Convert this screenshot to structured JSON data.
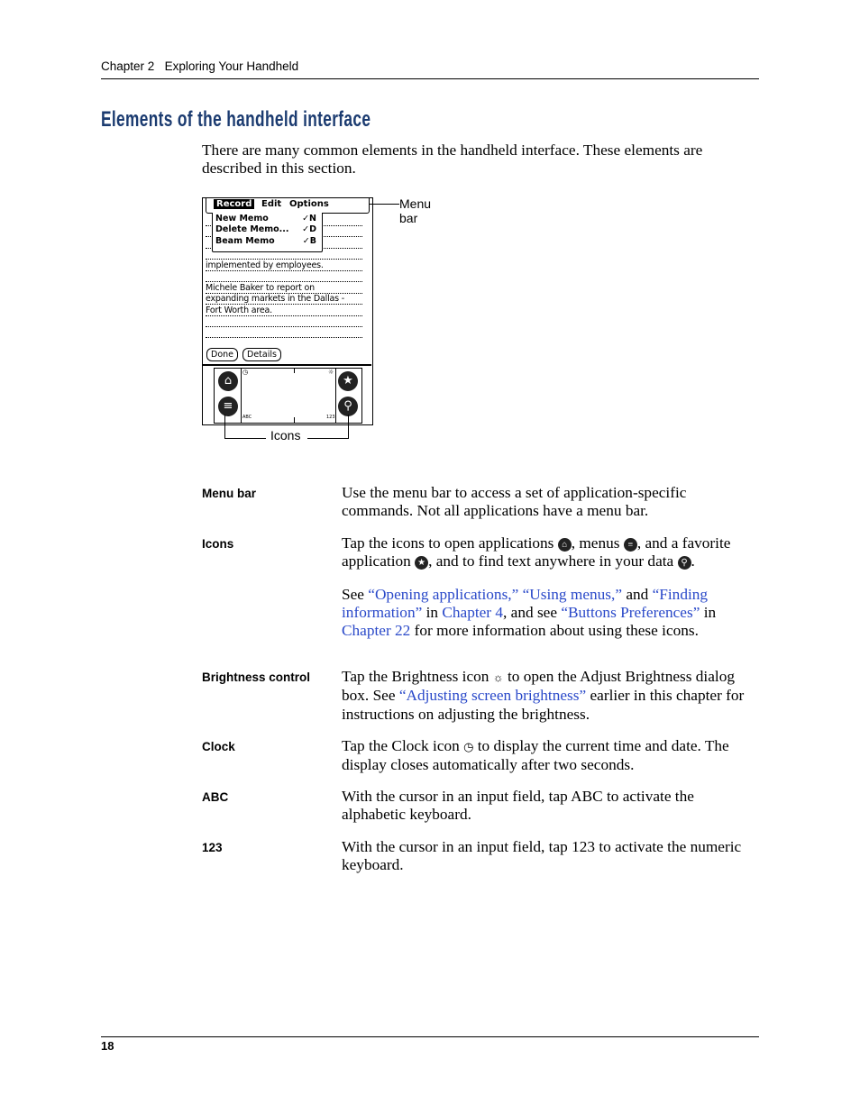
{
  "header": {
    "chapter": "Chapter 2",
    "section": "Exploring Your Handheld"
  },
  "title": "Elements of the handheld interface",
  "intro": "There are many common elements in the handheld interface. These elements are described in this section.",
  "figure": {
    "menus": [
      "Record",
      "Edit",
      "Options"
    ],
    "menu_items": [
      {
        "label": "New Memo",
        "shortcut": "✓N"
      },
      {
        "label": "Delete Memo...",
        "shortcut": "✓D"
      },
      {
        "label": "Beam Memo",
        "shortcut": "✓B"
      }
    ],
    "memo_lines": [
      "implemented by employees.",
      "Michele Baker to report on",
      "expanding markets in the Dallas -",
      "Fort Worth area."
    ],
    "buttons": [
      "Done",
      "Details"
    ],
    "silk": {
      "abc": "ABC",
      "num": "123"
    },
    "callout_menu_bar": "Menu bar",
    "callout_icons": "Icons"
  },
  "definitions": [
    {
      "term": "Menu bar",
      "paras": [
        [
          {
            "t": "Use the menu bar to access a set of application-specific commands. Not all applications have a menu bar."
          }
        ]
      ]
    },
    {
      "term": "Icons",
      "paras": [
        [
          {
            "t": "Tap the icons to open applications "
          },
          {
            "icon": "home-icon",
            "g": "⌂"
          },
          {
            "t": ", menus "
          },
          {
            "icon": "menu-icon",
            "g": "≡"
          },
          {
            "t": ", and a favorite application "
          },
          {
            "icon": "star-icon",
            "g": "★"
          },
          {
            "t": ", and to find text anywhere in your data "
          },
          {
            "icon": "find-icon",
            "g": "⚲"
          },
          {
            "t": "."
          }
        ],
        [
          {
            "t": "See "
          },
          {
            "t": "“Opening applications,”",
            "link": true
          },
          {
            "t": " "
          },
          {
            "t": "“Using menus,”",
            "link": true
          },
          {
            "t": " and "
          },
          {
            "t": "“Finding information”",
            "link": true
          },
          {
            "t": " in "
          },
          {
            "t": "Chapter 4",
            "link": true
          },
          {
            "t": ", and see "
          },
          {
            "t": "“Buttons Preferences”",
            "link": true
          },
          {
            "t": " in "
          },
          {
            "t": "Chapter 22",
            "link": true
          },
          {
            "t": " for more information about using these icons."
          }
        ]
      ]
    },
    {
      "term": "Brightness control",
      "paras": [
        [
          {
            "t": "Tap the Brightness icon "
          },
          {
            "sym": "brightness-icon",
            "g": "☼"
          },
          {
            "t": " to open the Adjust Brightness dialog box. See "
          },
          {
            "t": "“Adjusting screen brightness”",
            "link": true
          },
          {
            "t": " earlier in this chapter for instructions on adjusting the brightness."
          }
        ]
      ]
    },
    {
      "term": "Clock",
      "paras": [
        [
          {
            "t": "Tap the Clock icon "
          },
          {
            "sym": "clock-icon",
            "g": "◷"
          },
          {
            "t": " to display the current time and date. The display closes automatically after two seconds."
          }
        ]
      ]
    },
    {
      "term": "ABC",
      "paras": [
        [
          {
            "t": "With the cursor in an input field, tap ABC to activate the alphabetic keyboard."
          }
        ]
      ]
    },
    {
      "term": "123",
      "paras": [
        [
          {
            "t": "With the cursor in an input field, tap 123 to activate the numeric keyboard."
          }
        ]
      ]
    }
  ],
  "page_number": "18",
  "colors": {
    "title": "#1b3b70",
    "link": "#2a49c9"
  }
}
